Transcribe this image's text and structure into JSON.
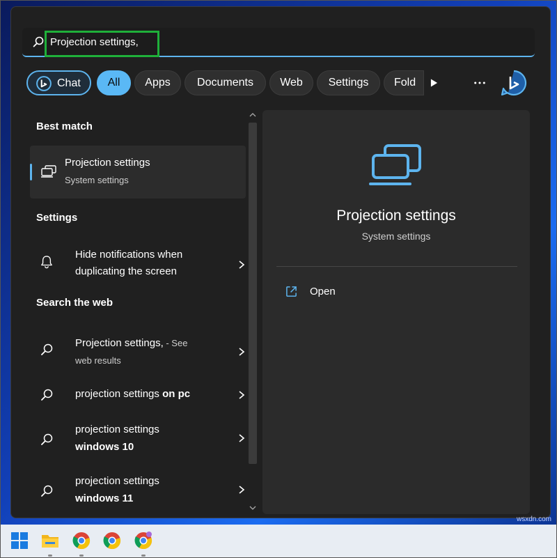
{
  "search": {
    "query": "Projection settings,"
  },
  "filters": {
    "chat": "Chat",
    "all": "All",
    "apps": "Apps",
    "documents": "Documents",
    "web": "Web",
    "settings": "Settings",
    "folders": "Fold"
  },
  "sections": {
    "best_match": "Best match",
    "settings": "Settings",
    "search_web": "Search the web"
  },
  "best_match": {
    "title": "Projection settings",
    "subtitle": "System settings"
  },
  "settings_results": [
    {
      "line1": "Hide notifications when",
      "line2": "duplicating the screen"
    }
  ],
  "web_results": [
    {
      "line1": "Projection settings,",
      "suffix": " - See",
      "line2": "web results"
    },
    {
      "prefix": "projection settings ",
      "bold": "on pc"
    },
    {
      "line1": "projection settings",
      "bold2": "windows 10"
    },
    {
      "line1": "projection settings",
      "bold2": "windows 11"
    }
  ],
  "preview": {
    "title": "Projection settings",
    "subtitle": "System settings",
    "open_label": "Open"
  },
  "colors": {
    "accent": "#5db4ee",
    "highlight": "#1fb03a",
    "panel": "#202020"
  },
  "watermark": "wsxdn.com",
  "icons": [
    "search-icon",
    "bing-icon",
    "play-icon",
    "more-icon",
    "projection-icon",
    "bell-icon",
    "chevron-right-icon",
    "open-external-icon",
    "windows-start-icon",
    "file-explorer-icon",
    "chrome-icon"
  ]
}
